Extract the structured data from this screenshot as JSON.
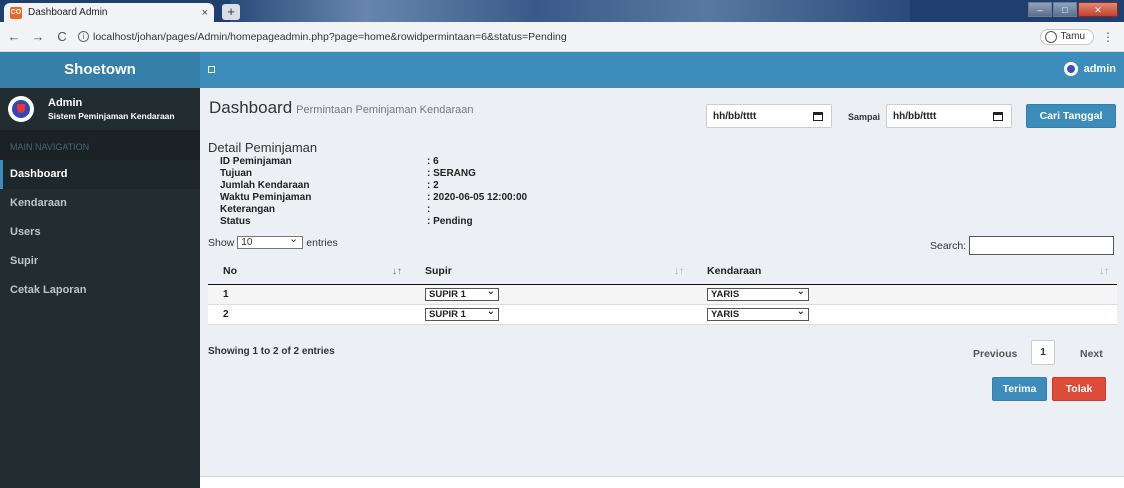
{
  "browser": {
    "tab_title": "Dashboard Admin",
    "tab_close": "×",
    "new_tab": "+",
    "favicon": "CO",
    "url": "localhost/johan/pages/Admin/homepageadmin.php?page=home&rowidpermintaan=6&status=Pending",
    "profile_label": "Tamu",
    "back": "←",
    "forward": "→",
    "reload": "C",
    "menu": "⋮"
  },
  "header": {
    "brand": "Shoetown",
    "user": "admin"
  },
  "sidebar": {
    "user_name": "Admin",
    "user_sub": "Sistem Peminjaman Kendaraan",
    "nav_header": "MAIN NAVIGATION",
    "items": [
      {
        "label": "Dashboard"
      },
      {
        "label": "Kendaraan"
      },
      {
        "label": "Users"
      },
      {
        "label": "Supir"
      },
      {
        "label": "Cetak Laporan"
      }
    ]
  },
  "page": {
    "title": "Dashboard",
    "subtitle": "Permintaan Peminjaman Kendaraan"
  },
  "filter": {
    "date_from": "hh/bb/tttt",
    "sampai_label": "Sampai",
    "date_to": "hh/bb/tttt",
    "button": "Cari Tanggal"
  },
  "detail": {
    "title": "Detail Peminjaman",
    "rows": [
      {
        "label": "ID Peminjaman",
        "value": ": 6"
      },
      {
        "label": "Tujuan",
        "value": ": SERANG"
      },
      {
        "label": "Jumlah Kendaraan",
        "value": ": 2"
      },
      {
        "label": "Waktu Peminjaman",
        "value": ": 2020-06-05 12:00:00"
      },
      {
        "label": "Keterangan",
        "value": ":"
      },
      {
        "label": "Status",
        "value": ": Pending"
      }
    ]
  },
  "table_controls": {
    "show_label": "Show",
    "entries_value": "10",
    "entries_label": "entries",
    "search_label": "Search:"
  },
  "table": {
    "headers": [
      "No",
      "Supir",
      "Kendaraan"
    ],
    "rows": [
      {
        "no": "1",
        "supir": "SUPIR 1",
        "kendaraan": "YARIS"
      },
      {
        "no": "2",
        "supir": "SUPIR 1",
        "kendaraan": "YARIS"
      }
    ]
  },
  "pagination": {
    "info": "Showing 1 to 2 of 2 entries",
    "previous": "Previous",
    "page": "1",
    "next": "Next"
  },
  "actions": {
    "accept": "Terima",
    "reject": "Tolak"
  },
  "colors": {
    "header": "#3c8dbc",
    "sidebar": "#222d32",
    "accept": "#3c8dbc",
    "reject": "#dd4b39"
  }
}
